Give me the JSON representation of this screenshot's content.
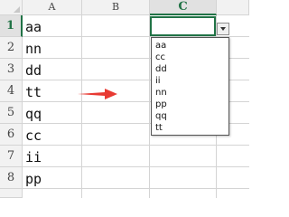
{
  "columns": [
    "A",
    "B",
    "C"
  ],
  "rows": [
    "1",
    "2",
    "3",
    "4",
    "5",
    "6",
    "7",
    "8"
  ],
  "column_a_values": [
    "aa",
    "nn",
    "dd",
    "tt",
    "qq",
    "cc",
    "ii",
    "pp"
  ],
  "active_cell": {
    "column": "C",
    "row": "1",
    "value": ""
  },
  "dropdown": {
    "is_open": true,
    "options": [
      "aa",
      "cc",
      "dd",
      "ii",
      "nn",
      "pp",
      "qq",
      "tt"
    ]
  },
  "colors": {
    "selection_green": "#217346",
    "arrow_red": "#e83a33",
    "header_gray": "#f2f2f2",
    "gridline": "#d4d4d4"
  },
  "icons": [
    "dropdown-chevron-icon",
    "right-arrow-icon",
    "select-all-triangle-icon"
  ]
}
